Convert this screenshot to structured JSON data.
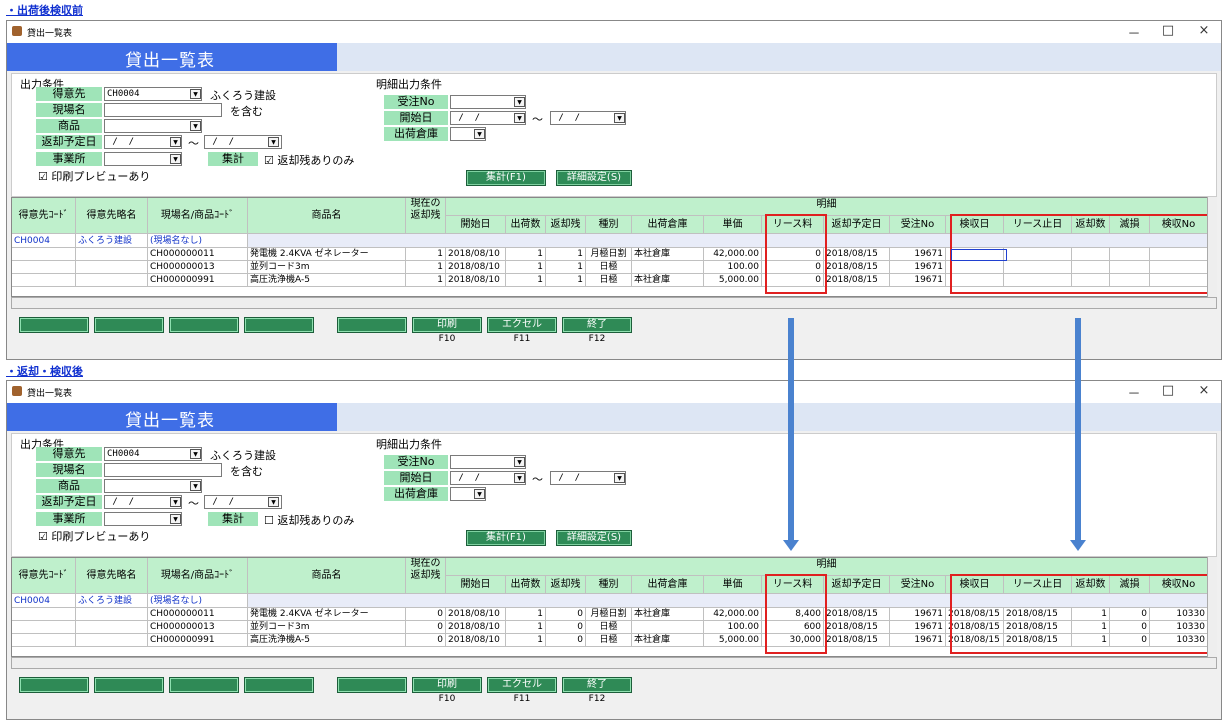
{
  "sections": [
    {
      "heading": "・出荷後検収前",
      "window": {
        "title": "貸出一覧表",
        "controls": [
          "－",
          "□",
          "×"
        ],
        "banner": "貸出一覧表",
        "cond": {
          "heading": "出力条件",
          "customer_label": "得意先",
          "customer_code": "CH0004",
          "customer_name": "ふくろう建設",
          "site_label": "現場名",
          "site_suffix": "を含む",
          "product_label": "商品",
          "return_label": "返却予定日",
          "date_blank": " /  /",
          "tilde": "～",
          "office_label": "事業所",
          "aggr_label": "集計",
          "remaining_only": "☑ 返却残ありのみ",
          "preview": "☑ 印刷プレビューあり",
          "detail_heading": "明細出力条件",
          "order_label": "受注No",
          "start_label": "開始日",
          "warehouse_label": "出荷倉庫",
          "btn_aggregate": "集計(F1)",
          "btn_detail": "詳細設定(S)"
        },
        "grid": {
          "headers": [
            "得意先ｺｰﾄﾞ",
            "得意先略名",
            "現場名/商品ｺｰﾄﾞ",
            "商品名",
            "現在の\n返却残",
            "明細",
            "開始日",
            "出荷数",
            "返却残",
            "種別",
            "出荷倉庫",
            "単価",
            "リース料",
            "返却予定日",
            "受注No",
            "検収日",
            "リース止日",
            "返却数",
            "滅損",
            "検収No"
          ],
          "group_row": {
            "code": "CH0004",
            "name": "ふくろう建設",
            "site": "(現場名なし)"
          },
          "rows": [
            {
              "code": "CH000000011",
              "name": "発電機 2.4KVA ゼネレーター",
              "remain": "1",
              "start": "2018/08/10",
              "ship": "1",
              "ret": "1",
              "kind": "月極日割",
              "wh": "本社倉庫",
              "price": "42,000.00",
              "lease": "0",
              "due": "2018/08/15",
              "order": "19671",
              "insp": "",
              "stop": "",
              "retq": "",
              "loss": "",
              "no": ""
            },
            {
              "code": "CH000000013",
              "name": "並列コード3m",
              "remain": "1",
              "start": "2018/08/10",
              "ship": "1",
              "ret": "1",
              "kind": "日極",
              "wh": "",
              "price": "100.00",
              "lease": "0",
              "due": "2018/08/15",
              "order": "19671",
              "insp": "",
              "stop": "",
              "retq": "",
              "loss": "",
              "no": ""
            },
            {
              "code": "CH000000991",
              "name": "高圧洗浄機A-5",
              "remain": "1",
              "start": "2018/08/10",
              "ship": "1",
              "ret": "1",
              "kind": "日極",
              "wh": "本社倉庫",
              "price": "5,000.00",
              "lease": "0",
              "due": "2018/08/15",
              "order": "19671",
              "insp": "",
              "stop": "",
              "retq": "",
              "loss": "",
              "no": ""
            }
          ]
        },
        "fbuttons": [
          {
            "label": "印刷",
            "key": "F10"
          },
          {
            "label": "エクセル",
            "key": "F11"
          },
          {
            "label": "終了",
            "key": "F12"
          }
        ]
      }
    },
    {
      "heading": "・返却・検収後",
      "window": {
        "title": "貸出一覧表",
        "controls": [
          "－",
          "□",
          "×"
        ],
        "banner": "貸出一覧表",
        "cond": {
          "heading": "出力条件",
          "customer_label": "得意先",
          "customer_code": "CH0004",
          "customer_name": "ふくろう建設",
          "site_label": "現場名",
          "site_suffix": "を含む",
          "product_label": "商品",
          "return_label": "返却予定日",
          "date_blank": " /  /",
          "tilde": "～",
          "office_label": "事業所",
          "aggr_label": "集計",
          "remaining_only": "☐ 返却残ありのみ",
          "preview": "☑ 印刷プレビューあり",
          "detail_heading": "明細出力条件",
          "order_label": "受注No",
          "start_label": "開始日",
          "warehouse_label": "出荷倉庫",
          "btn_aggregate": "集計(F1)",
          "btn_detail": "詳細設定(S)"
        },
        "grid": {
          "headers": [
            "得意先ｺｰﾄﾞ",
            "得意先略名",
            "現場名/商品ｺｰﾄﾞ",
            "商品名",
            "現在の\n返却残",
            "明細",
            "開始日",
            "出荷数",
            "返却残",
            "種別",
            "出荷倉庫",
            "単価",
            "リース料",
            "返却予定日",
            "受注No",
            "検収日",
            "リース止日",
            "返却数",
            "滅損",
            "検収No"
          ],
          "group_row": {
            "code": "CH0004",
            "name": "ふくろう建設",
            "site": "(現場名なし)"
          },
          "rows": [
            {
              "code": "CH000000011",
              "name": "発電機 2.4KVA ゼネレーター",
              "remain": "0",
              "start": "2018/08/10",
              "ship": "1",
              "ret": "0",
              "kind": "月極日割",
              "wh": "本社倉庫",
              "price": "42,000.00",
              "lease": "8,400",
              "due": "2018/08/15",
              "order": "19671",
              "insp": "2018/08/15",
              "stop": "2018/08/15",
              "retq": "1",
              "loss": "0",
              "no": "10330"
            },
            {
              "code": "CH000000013",
              "name": "並列コード3m",
              "remain": "0",
              "start": "2018/08/10",
              "ship": "1",
              "ret": "0",
              "kind": "日極",
              "wh": "",
              "price": "100.00",
              "lease": "600",
              "due": "2018/08/15",
              "order": "19671",
              "insp": "2018/08/15",
              "stop": "2018/08/15",
              "retq": "1",
              "loss": "0",
              "no": "10330"
            },
            {
              "code": "CH000000991",
              "name": "高圧洗浄機A-5",
              "remain": "0",
              "start": "2018/08/10",
              "ship": "1",
              "ret": "0",
              "kind": "日極",
              "wh": "本社倉庫",
              "price": "5,000.00",
              "lease": "30,000",
              "due": "2018/08/15",
              "order": "19671",
              "insp": "2018/08/15",
              "stop": "2018/08/15",
              "retq": "1",
              "loss": "0",
              "no": "10330"
            }
          ]
        },
        "fbuttons": [
          {
            "label": "印刷",
            "key": "F10"
          },
          {
            "label": "エクセル",
            "key": "F11"
          },
          {
            "label": "終了",
            "key": "F12"
          }
        ]
      }
    }
  ]
}
